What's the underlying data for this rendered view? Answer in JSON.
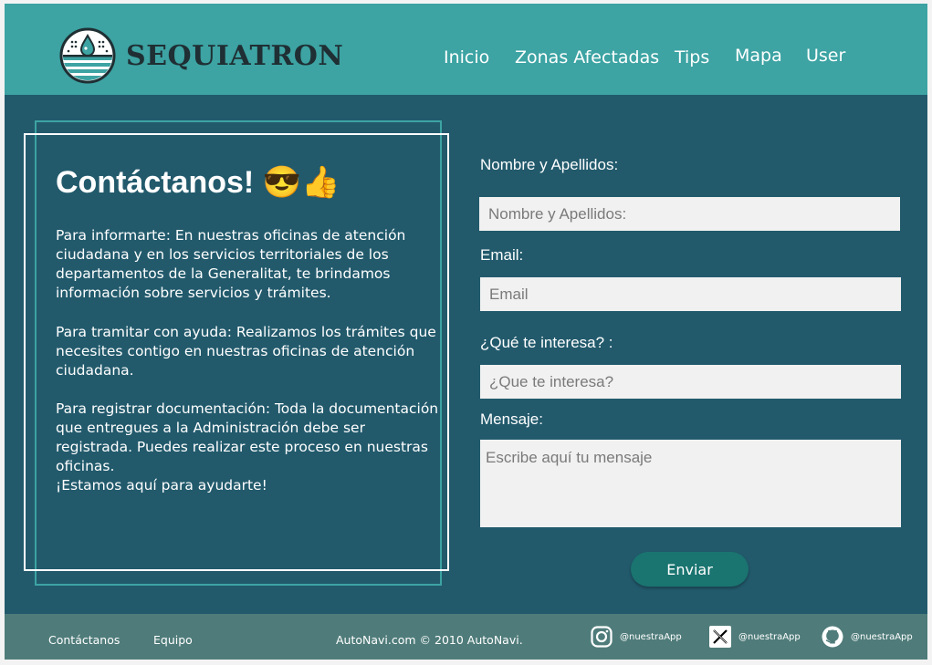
{
  "brand": {
    "name": "SEQUIATRON",
    "logo_icon": "water-drop-logo-icon"
  },
  "nav": {
    "items": [
      "Inicio",
      "Zonas Afectadas",
      "Tips",
      "Mapa",
      "User"
    ]
  },
  "contact_card": {
    "title": "Contáctanos! 😎👍",
    "paragraphs": [
      "Para informarte: En nuestras oficinas de atención ciudadana y en los servicios territoriales de los departamentos de la Generalitat, te brindamos información sobre servicios y trámites.",
      "Para tramitar con ayuda: Realizamos los trámites que necesites contigo en nuestras oficinas de atención ciudadana.",
      "Para registrar documentación: Toda la documentación que entregues a la Administración debe ser registrada. Puedes realizar este proceso en nuestras oficinas.",
      "¡Estamos aquí para ayudarte!"
    ]
  },
  "form": {
    "name_label": "Nombre y Apellidos:",
    "name_placeholder": "Nombre y Apellidos:",
    "name_value": "",
    "email_label": "Email:",
    "email_placeholder": "Email",
    "email_value": "",
    "interest_label": "¿Qué te interesa? :",
    "interest_placeholder": "¿Que te interesa?",
    "interest_value": "",
    "message_label": "Mensaje:",
    "message_placeholder": "Escribe aquí tu mensaje",
    "message_value": "",
    "submit_label": "Enviar"
  },
  "footer": {
    "links": [
      "Contáctanos",
      "Equipo"
    ],
    "copyright": "AutoNavi.com © 2010 AutoNavi.",
    "social": [
      {
        "icon": "instagram-icon",
        "handle": "@nuestraApp"
      },
      {
        "icon": "x-twitter-icon",
        "handle": "@nuestraApp"
      },
      {
        "icon": "github-icon",
        "handle": "@nuestraApp"
      }
    ]
  },
  "colors": {
    "header_bg": "#3da3a3",
    "page_bg": "#225a6c",
    "footer_bg": "#4f7c7a",
    "button_bg": "#1a7470",
    "field_bg": "#f1f1f1"
  }
}
